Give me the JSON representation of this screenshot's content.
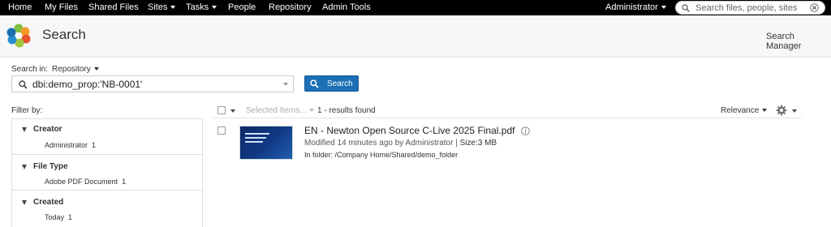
{
  "nav": {
    "items": [
      {
        "label": "Home",
        "dropdown": false
      },
      {
        "label": "My Files",
        "dropdown": false
      },
      {
        "label": "Shared Files",
        "dropdown": false
      },
      {
        "label": "Sites",
        "dropdown": true
      },
      {
        "label": "Tasks",
        "dropdown": true
      },
      {
        "label": "People",
        "dropdown": false
      },
      {
        "label": "Repository",
        "dropdown": false
      },
      {
        "label": "Admin Tools",
        "dropdown": false
      }
    ],
    "user": "Administrator",
    "search_placeholder": "Search files, people, sites"
  },
  "header": {
    "title": "Search",
    "search_manager": "Search Manager"
  },
  "search": {
    "search_in_label": "Search in:",
    "search_in_value": "Repository",
    "query": "dbi:demo_prop:'NB-0001'",
    "button_label": "Search"
  },
  "filters": {
    "label": "Filter by:",
    "facets": [
      {
        "title": "Creator",
        "value": "Administrator",
        "count": "1"
      },
      {
        "title": "File Type",
        "value": "Adobe PDF Document",
        "count": "1"
      },
      {
        "title": "Created",
        "value": "Today",
        "count": "1"
      }
    ]
  },
  "results": {
    "selected_items": "Selected Items...",
    "found": "1 - results found",
    "sort": "Relevance",
    "items": [
      {
        "title": "EN - Newton Open Source C-Live 2025 Final.pdf",
        "modified": "Modified 14 minutes ago by Administrator",
        "size": "Size:3 MB",
        "folder": "In folder: /Company Home/Shared/demo_folder"
      }
    ]
  },
  "colors": {
    "nav_bg": "#000000",
    "header_bg": "#f6f7f8",
    "accent_button": "#1c6fb4"
  }
}
